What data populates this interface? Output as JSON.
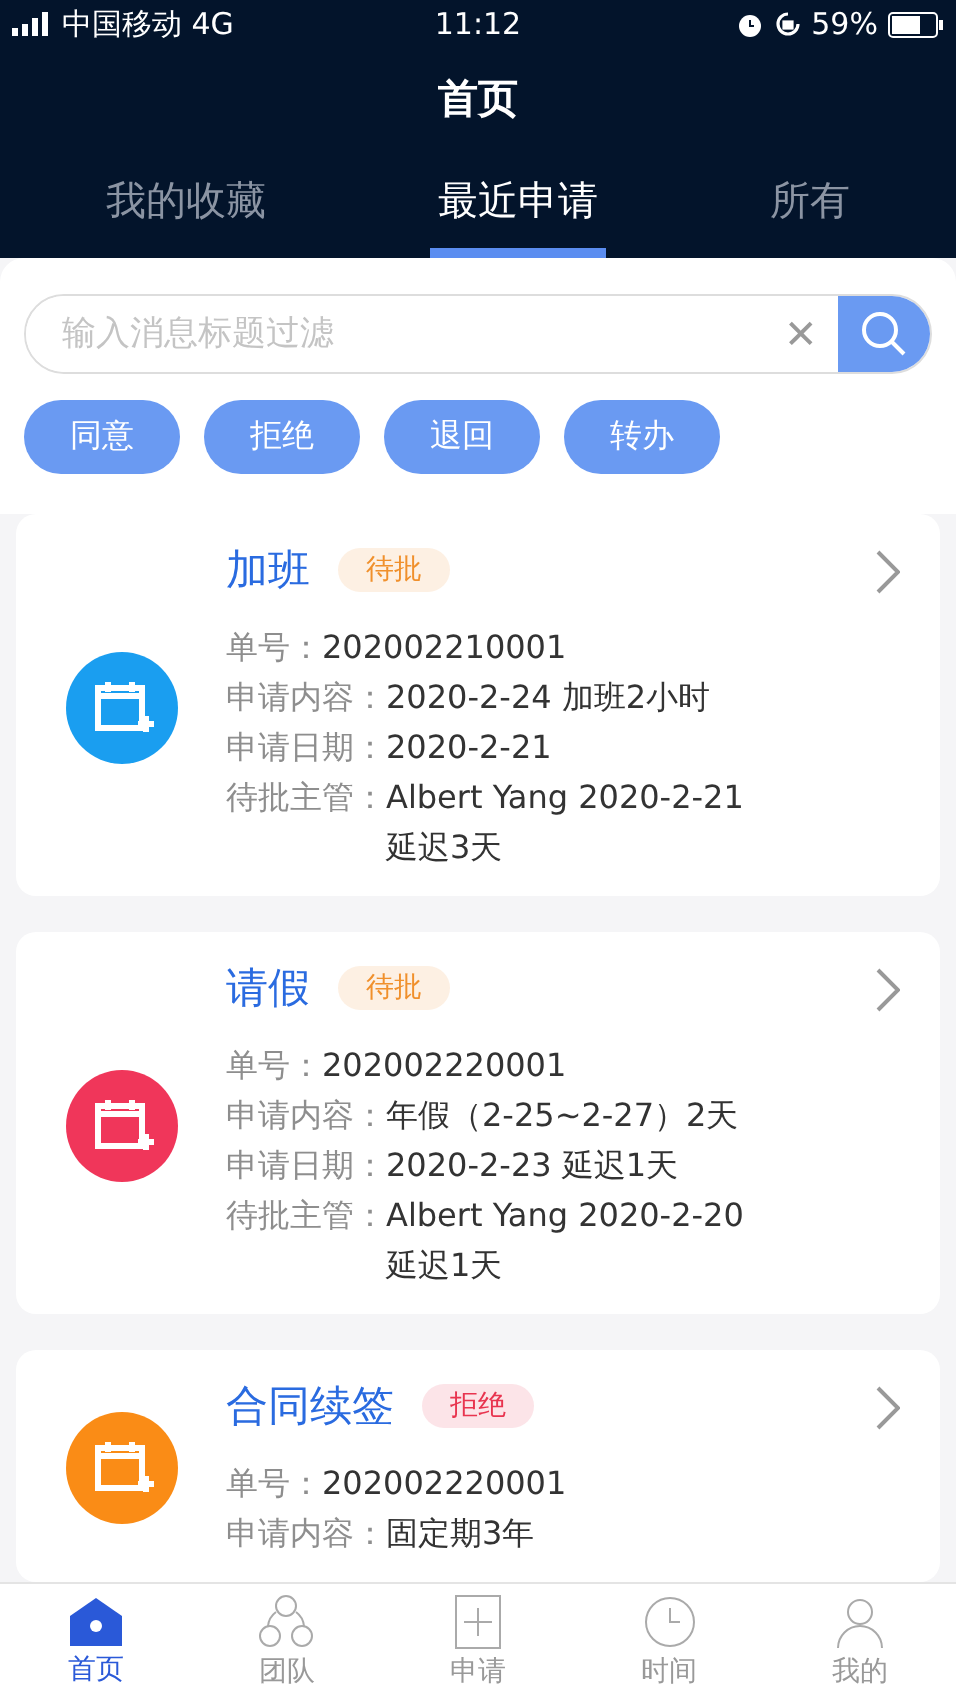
{
  "status_bar": {
    "carrier": "中国移动 4G",
    "time": "11:12",
    "battery": "59%"
  },
  "header": {
    "title": "首页"
  },
  "tabs": [
    {
      "label": "我的收藏",
      "selected": false
    },
    {
      "label": "最近申请",
      "selected": true
    },
    {
      "label": "所有",
      "selected": false
    }
  ],
  "search": {
    "placeholder": "输入消息标题过滤",
    "clear": "✕"
  },
  "filters": [
    "同意",
    "拒绝",
    "退回",
    "转办"
  ],
  "cards": [
    {
      "title": "加班",
      "status": {
        "label": "待批",
        "color": "#f0902c"
      },
      "color": "#1a9ef0",
      "rows": [
        {
          "label": "单号：",
          "value": "202002210001"
        },
        {
          "label": "申请内容：",
          "value": "2020-2-24 加班2小时"
        },
        {
          "label": "申请日期：",
          "value": "2020-2-21"
        },
        {
          "label": "待批主管：",
          "value": "Albert Yang 2020-2-21 延迟3天"
        }
      ]
    },
    {
      "title": "请假",
      "status": {
        "label": "待批",
        "color": "#f0902c"
      },
      "color": "#f0365a",
      "rows": [
        {
          "label": "单号：",
          "value": "202002220001"
        },
        {
          "label": "申请内容：",
          "value": "年假（2-25~2-27）2天"
        },
        {
          "label": "申请日期：",
          "value": "2020-2-23 延迟1天"
        },
        {
          "label": "待批主管：",
          "value": "Albert Yang 2020-2-20 延迟1天"
        }
      ]
    },
    {
      "title": "合同续签",
      "status": {
        "label": "拒绝",
        "color": "#e8344f"
      },
      "color": "#fa8c16",
      "rows": [
        {
          "label": "单号：",
          "value": "202002220001"
        },
        {
          "label": "申请内容：",
          "value": "固定期3年"
        }
      ]
    }
  ],
  "bottom_nav": [
    {
      "label": "首页",
      "selected": true,
      "kind": "home"
    },
    {
      "label": "团队",
      "selected": false,
      "kind": "team"
    },
    {
      "label": "申请",
      "selected": false,
      "kind": "apply"
    },
    {
      "label": "时间",
      "selected": false,
      "kind": "time"
    },
    {
      "label": "我的",
      "selected": false,
      "kind": "me"
    }
  ]
}
